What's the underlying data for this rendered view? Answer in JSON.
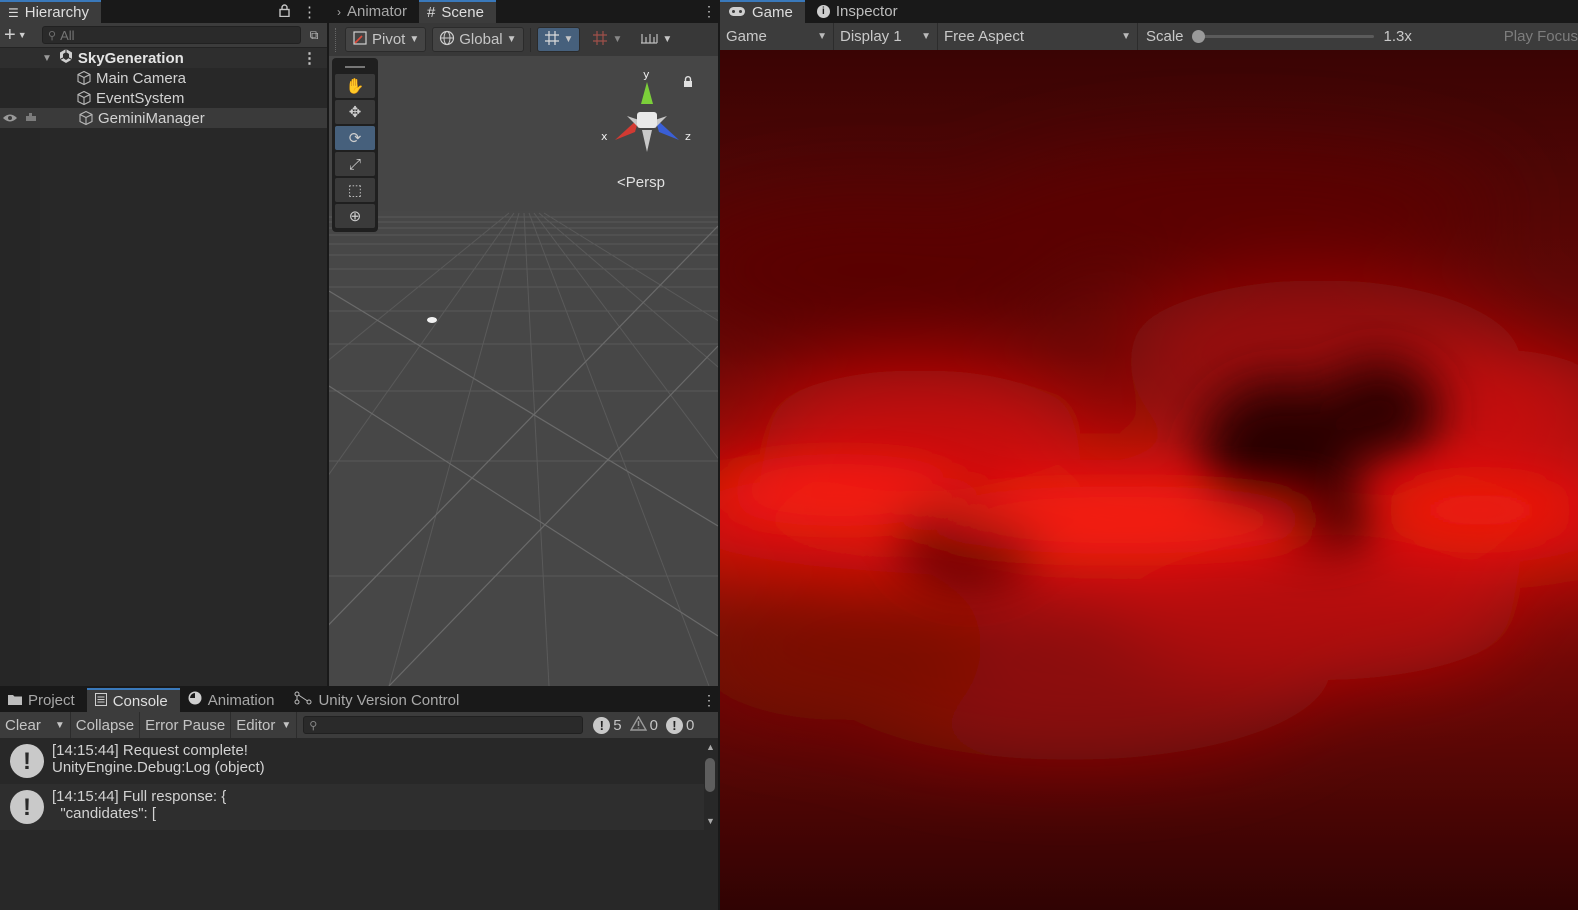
{
  "hierarchy": {
    "tab_label": "Hierarchy",
    "search_placeholder": "All",
    "scene_name": "SkyGeneration",
    "items": [
      {
        "label": "Main Camera"
      },
      {
        "label": "EventSystem"
      },
      {
        "label": "GeminiManager"
      }
    ]
  },
  "scene_panel": {
    "tabs": [
      {
        "label": "Animator"
      },
      {
        "label": "Scene"
      }
    ],
    "pivot_label": "Pivot",
    "global_label": "Global",
    "persp_label": "Persp",
    "gizmo_axes": {
      "x": "x",
      "y": "y",
      "z": "z"
    }
  },
  "game_panel": {
    "tabs": [
      {
        "label": "Game"
      },
      {
        "label": "Inspector"
      }
    ],
    "view_select": "Game",
    "display_select": "Display 1",
    "aspect_select": "Free Aspect",
    "scale_label": "Scale",
    "scale_value": "1.3x",
    "play_focus": "Play Focus",
    "sky_color": "#e8150e"
  },
  "console_panel": {
    "tabs": [
      {
        "label": "Project"
      },
      {
        "label": "Console"
      },
      {
        "label": "Animation"
      },
      {
        "label": "Unity Version Control"
      }
    ],
    "clear_label": "Clear",
    "collapse_label": "Collapse",
    "error_pause_label": "Error Pause",
    "editor_label": "Editor",
    "counts": {
      "log": "5",
      "warning": "0",
      "error": "0"
    },
    "logs": [
      {
        "line1": "[14:15:44] Request complete!",
        "line2": "UnityEngine.Debug:Log (object)"
      },
      {
        "line1": "[14:15:44] Full response: {",
        "line2": "  \"candidates\": ["
      }
    ]
  }
}
